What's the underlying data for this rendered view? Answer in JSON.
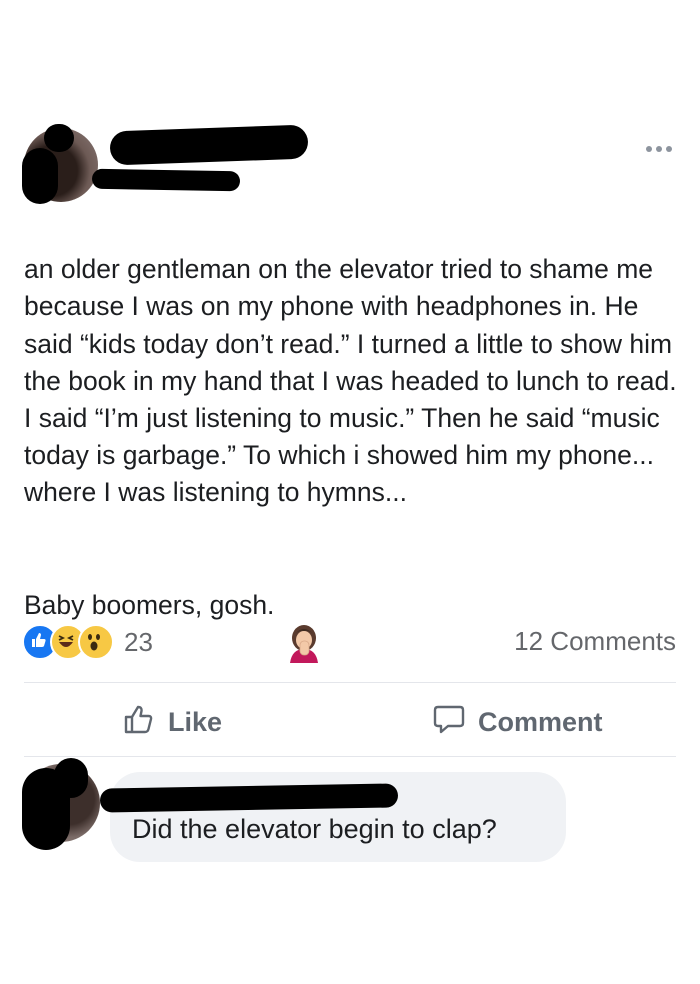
{
  "post": {
    "author_name": "",
    "paragraphs": [
      "an older gentleman on the elevator tried to shame me because I was on my phone with headphones in. He said “kids today don’t read.” I turned a little to show him the book in my hand that I was headed to lunch to read. I said “I’m just listening to music.” Then he said “music today is garbage.” To which i showed him my phone... where I was listening to hymns..."
    ],
    "closing_line": "Baby boomers, gosh.",
    "closing_emoji": "facepalm-woman-emoji"
  },
  "reactions": {
    "icons": [
      "like-reaction-icon",
      "haha-reaction-icon",
      "wow-reaction-icon"
    ],
    "count": "23"
  },
  "comments_count": "12 Comments",
  "actions": {
    "like_label": "Like",
    "comment_label": "Comment"
  },
  "comment": {
    "author_name": "",
    "text": "Did the elevator begin to clap?"
  },
  "colors": {
    "like_blue": "#1877f2",
    "muted_gray": "#65676b",
    "bubble_bg": "#f0f2f5",
    "redaction": "#000000"
  }
}
